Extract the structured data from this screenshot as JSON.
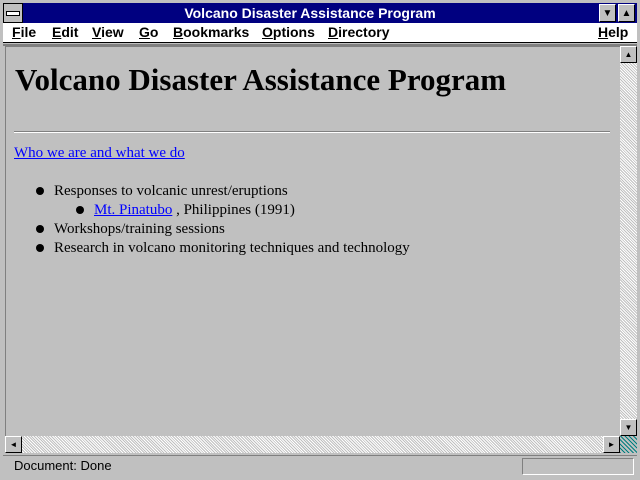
{
  "window": {
    "title": "Volcano Disaster Assistance Program",
    "min_glyph": "▼",
    "max_glyph": "▲"
  },
  "menu": {
    "items": [
      "File",
      "Edit",
      "View",
      "Go",
      "Bookmarks",
      "Options",
      "Directory",
      "Help"
    ]
  },
  "page": {
    "heading": "Volcano Disaster Assistance Program",
    "intro_link": "Who we are and what we do",
    "list": [
      {
        "text": "Responses to volcanic unrest/eruptions"
      },
      {
        "sub_link": "Mt. Pinatubo",
        "sub_text": ", Philippines (1991)"
      },
      {
        "text": "Workshops/training sessions"
      },
      {
        "text": "Research in volcano monitoring techniques and technology"
      }
    ]
  },
  "status": {
    "text": "Document: Done"
  },
  "scroll": {
    "up": "▲",
    "down": "▼",
    "left": "◄",
    "right": "►"
  }
}
